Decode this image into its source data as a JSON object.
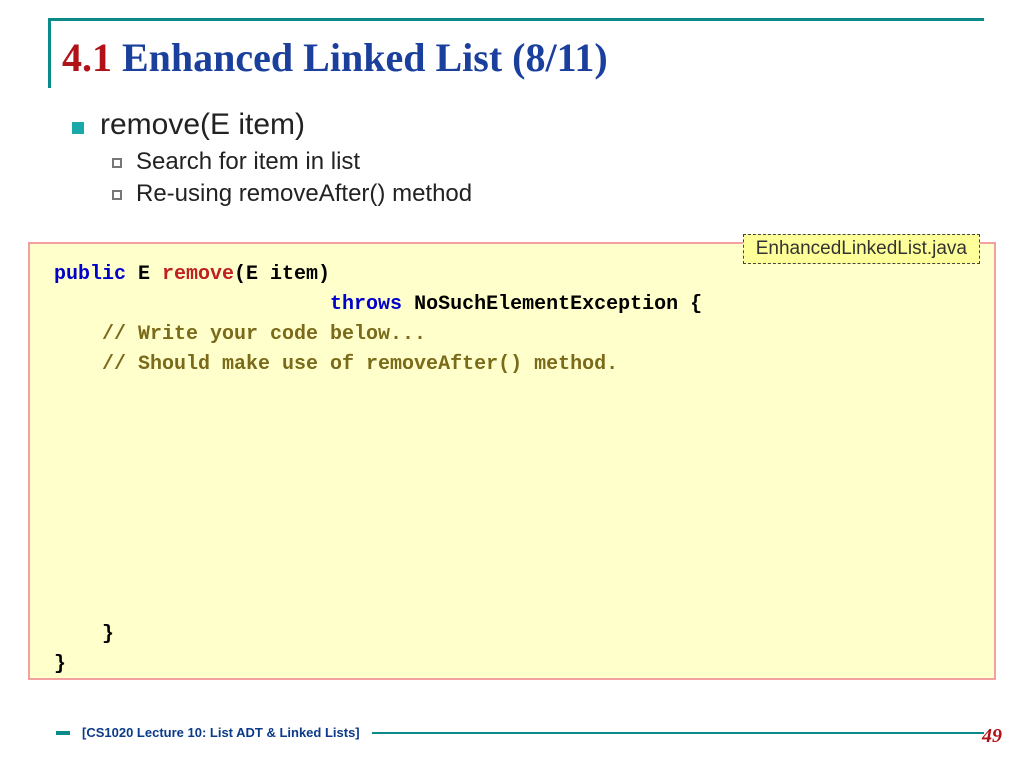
{
  "title": {
    "section": "4.1",
    "text": "Enhanced Linked List (8/11)"
  },
  "bullets": {
    "main": "remove(E item)",
    "subs": [
      "Search for item in list",
      "Re-using removeAfter() method"
    ]
  },
  "file_tag": "EnhancedLinkedList.java",
  "code": {
    "l1_kw": "public",
    "l1_mid": " E ",
    "l1_nm": "remove",
    "l1_end": "(E item)",
    "l2_pad": "                       ",
    "l2_kw": "throws",
    "l2_end": " NoSuchElementException {",
    "c1": "    // Write your code below...",
    "c2": "    // Should make use of removeAfter() method.",
    "close1": "    }",
    "close2": "}"
  },
  "footer": {
    "text": "[CS1020 Lecture 10: List ADT & Linked Lists]"
  },
  "page_number": "49"
}
